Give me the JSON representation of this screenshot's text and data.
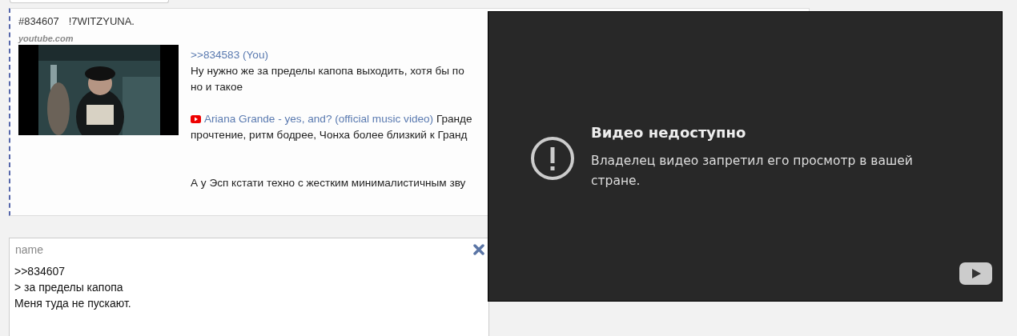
{
  "post": {
    "number": "#834607",
    "trip": "!7WITZYUNA.",
    "embed": {
      "source": "youtube.com"
    },
    "lines": [
      {
        "kind": "reply",
        "text": ">>834583 (You)"
      },
      {
        "kind": "text",
        "text": "Ну нужно же за пределы капопа выходить, хотя бы по"
      },
      {
        "kind": "text",
        "text": "но и такое"
      },
      {
        "kind": "gap"
      },
      {
        "kind": "video",
        "link": "Ariana Grande - yes, and? (official music video)",
        "text": "Гранде"
      },
      {
        "kind": "text",
        "text": "прочтение, ритм бодрее, Чонха более близкий к Гранд"
      },
      {
        "kind": "gap"
      },
      {
        "kind": "gap"
      },
      {
        "kind": "text",
        "text": "А у Эсп кстати техно с жестким минималистичным зву"
      }
    ]
  },
  "reply_form": {
    "name": {
      "placeholder": "name"
    },
    "message": ">>834607\n> за пределы капопа\nМеня туда не пускают."
  },
  "player": {
    "title": "Видео недоступно",
    "message": "Владелец видео запретил его просмотр в вашей стране."
  }
}
